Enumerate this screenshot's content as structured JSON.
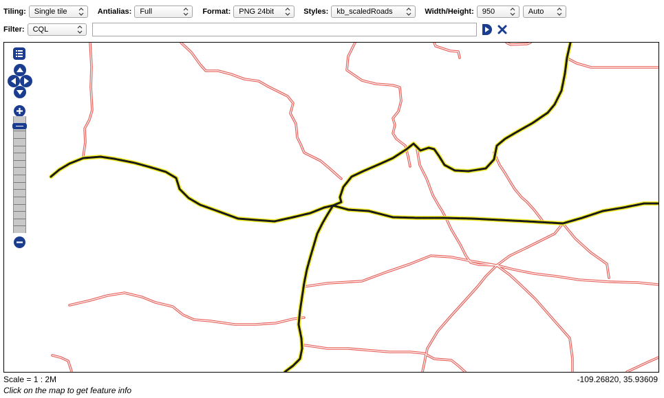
{
  "toolbar": {
    "tiling": {
      "label": "Tiling:",
      "value": "Single tile"
    },
    "antialias": {
      "label": "Antialias:",
      "value": "Full"
    },
    "format": {
      "label": "Format:",
      "value": "PNG 24bit"
    },
    "styles": {
      "label": "Styles:",
      "value": "kb_scaledRoads"
    },
    "size": {
      "label": "Width/Height:",
      "width": "950",
      "height": "Auto"
    },
    "filter": {
      "label": "Filter:",
      "type": "CQL",
      "value": ""
    }
  },
  "map": {
    "colors": {
      "major_road": "#1a1a1a",
      "major_road_halo": "#f2ec2c",
      "minor_road": "#e8605a",
      "minor_road_core": "#ffffff",
      "nav_control": "#1b3d8f"
    },
    "controls": {
      "layer_switcher_icon": "list-icon",
      "pan_icon": "pan-arrows-icon",
      "zoom_in_icon": "plus-icon",
      "zoom_out_icon": "minus-icon",
      "zoom_levels": 16,
      "zoom_level": 15
    }
  },
  "status": {
    "scale": "Scale = 1 : 2M",
    "coordinates": "-109.26820, 35.93609",
    "hint": "Click on the map to get feature info"
  }
}
